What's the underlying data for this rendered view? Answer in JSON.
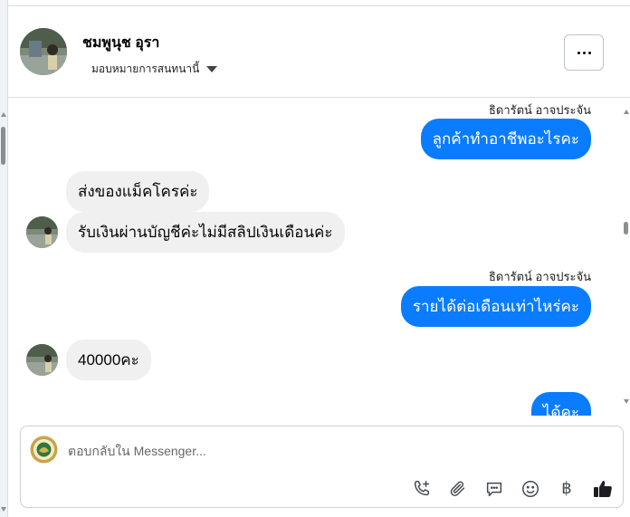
{
  "header": {
    "name": "ชมพูนุช อุรา",
    "assign_label": "มอบหมายการสนทนานี้"
  },
  "messages": [
    {
      "direction": "out",
      "sender": "ธิดารัตน์ อาจประจัน",
      "text": "ลูกค้าทำอาชีพอะไรคะ"
    },
    {
      "direction": "in",
      "text": "ส่งของแม็คโครค่ะ"
    },
    {
      "direction": "in",
      "text": "รับเงินผ่านบัญชีค่ะไม่มีสลิปเงินเดือนค่ะ"
    },
    {
      "direction": "out",
      "sender": "ธิดารัตน์ อาจประจัน",
      "text": "รายได้ต่อเดือนเท่าไหร่คะ"
    },
    {
      "direction": "in",
      "text": "40000คะ"
    },
    {
      "direction": "out",
      "text": "ได้คะ"
    }
  ],
  "composer": {
    "placeholder": "ตอบกลับใน Messenger...",
    "tools": [
      "call-add-icon",
      "attachment-icon",
      "saved-reply-icon",
      "emoji-icon",
      "baht-payment-icon",
      "thumbs-up-icon"
    ],
    "baht_symbol": "฿"
  },
  "colors": {
    "outgoing_bubble": "#0a7cff",
    "incoming_bubble": "#f0f0f0",
    "thumbs_up": "#1c1e21"
  }
}
